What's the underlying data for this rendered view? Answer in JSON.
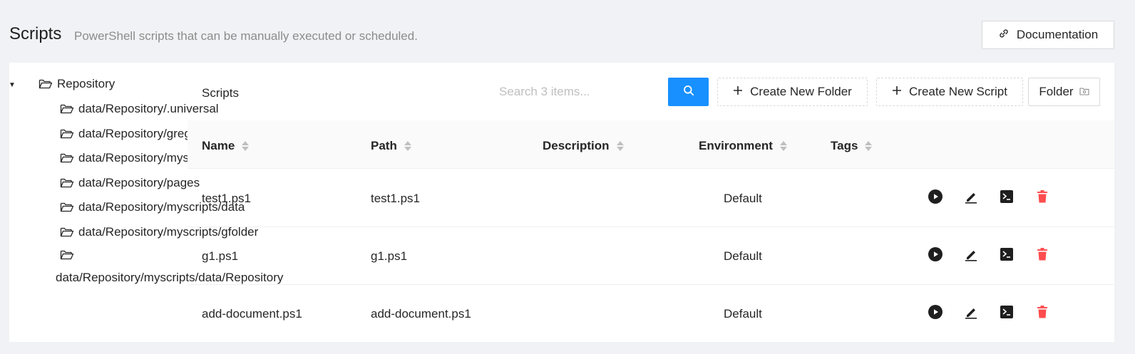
{
  "header": {
    "title": "Scripts",
    "subtitle": "PowerShell scripts that can be manually executed or scheduled.",
    "doc_button": "Documentation"
  },
  "tree": {
    "root": "Repository",
    "items": [
      "data/Repository/.universal",
      "data/Repository/greg",
      "data/Repository/myscripts",
      "data/Repository/pages",
      "data/Repository/myscripts/data",
      "data/Repository/myscripts/gfolder",
      "data/Repository/myscripts/data/Repository"
    ]
  },
  "toolbar": {
    "title": "Scripts",
    "search_placeholder": "Search 3 items...",
    "create_folder": "Create New Folder",
    "create_script": "Create New Script",
    "folder": "Folder"
  },
  "table": {
    "columns": [
      "Name",
      "Path",
      "Description",
      "Environment",
      "Tags"
    ],
    "rows": [
      {
        "name": "test1.ps1",
        "path": "test1.ps1",
        "description": "",
        "environment": "Default",
        "tags": ""
      },
      {
        "name": "g1.ps1",
        "path": "g1.ps1",
        "description": "",
        "environment": "Default",
        "tags": ""
      },
      {
        "name": "add-document.ps1",
        "path": "add-document.ps1",
        "description": "",
        "environment": "Default",
        "tags": ""
      }
    ]
  },
  "icons": {
    "doc": "link-icon",
    "search": "search-icon",
    "plus": "plus-icon",
    "folder": "folder-open-icon",
    "run": "play-circle-icon",
    "edit": "edit-icon",
    "terminal": "terminal-icon",
    "delete": "delete-icon"
  },
  "colors": {
    "primary": "#1890ff",
    "danger": "#ff4d4f",
    "background": "#f0f2f5"
  }
}
